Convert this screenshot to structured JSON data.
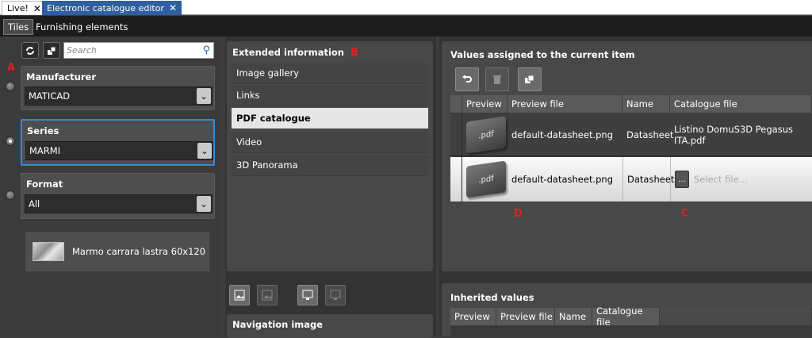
{
  "tabs": {
    "live": {
      "label": "Live!",
      "close": "✕"
    },
    "editor": {
      "label": "Electronic catalogue editor",
      "close": "✕"
    }
  },
  "subtabs": [
    "Tiles",
    "Furnishing elements"
  ],
  "search": {
    "placeholder": "Search"
  },
  "filters": {
    "manufacturer": {
      "label": "Manufacturer",
      "value": "MATICAD"
    },
    "series": {
      "label": "Series",
      "value": "MARMI"
    },
    "format": {
      "label": "Format",
      "value": "All"
    }
  },
  "item": {
    "name": "Marmo carrara lastra 60x120"
  },
  "markers": {
    "a": "A",
    "b": "B",
    "c": "C",
    "d": "D"
  },
  "extended": {
    "title": "Extended information",
    "items": [
      "Image gallery",
      "Links",
      "PDF catalogue",
      "Video",
      "3D Panorama"
    ],
    "selected": "PDF catalogue"
  },
  "navigation": {
    "title": "Navigation image"
  },
  "assigned": {
    "title": "Values assigned to the current item",
    "columns": [
      "Preview",
      "Preview file",
      "Name",
      "Catalogue file"
    ],
    "rows": [
      {
        "preview": ".pdf",
        "preview_file": "default-datasheet.png",
        "name": "Datasheet",
        "catalogue_file": "Listino DomuS3D Pegasus ITA.pdf"
      },
      {
        "preview": ".pdf",
        "preview_file": "default-datasheet.png",
        "name": "Datasheet",
        "catalogue_file": "Select file...",
        "browse": "..."
      }
    ]
  },
  "inherited": {
    "title": "Inherited values",
    "columns": [
      "Preview",
      "Preview file",
      "Name",
      "Catalogue file"
    ]
  },
  "colors": {
    "accent": "#2f5f9e",
    "marker": "#e02020",
    "selection_border": "#3a86d8"
  }
}
